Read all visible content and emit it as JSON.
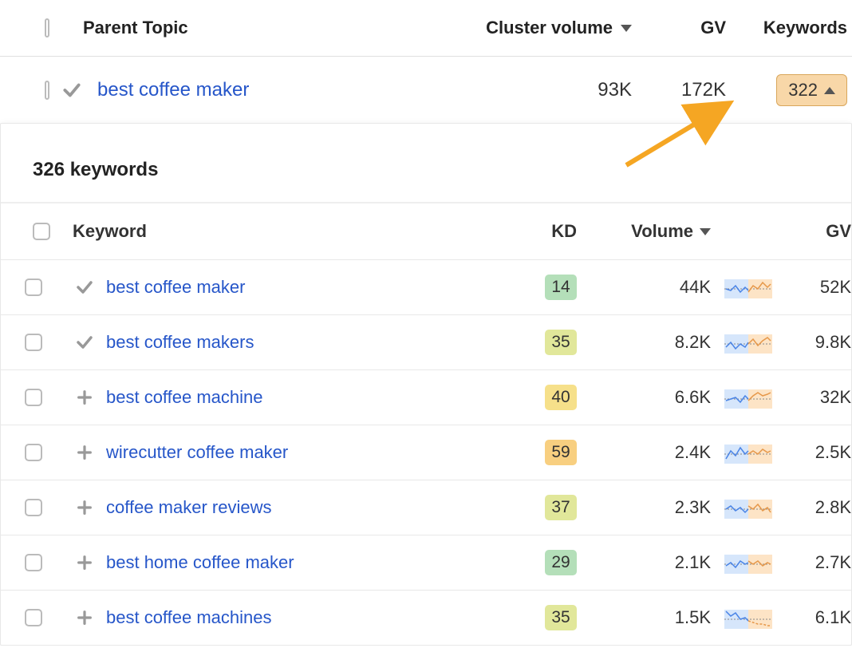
{
  "parent_table": {
    "headers": {
      "parent_topic": "Parent Topic",
      "cluster_volume": "Cluster volume",
      "gv": "GV",
      "keywords": "Keywords"
    },
    "row": {
      "topic": "best coffee maker",
      "cluster_volume": "93K",
      "gv": "172K",
      "keywords_count": "322"
    }
  },
  "panel": {
    "title": "326 keywords",
    "headers": {
      "keyword": "Keyword",
      "kd": "KD",
      "volume": "Volume",
      "gv": "GV"
    },
    "rows": [
      {
        "status": "check",
        "keyword": "best coffee maker",
        "kd": "14",
        "kd_class": "kd-green",
        "volume": "44K",
        "gv": "52K"
      },
      {
        "status": "check",
        "keyword": "best coffee makers",
        "kd": "35",
        "kd_class": "kd-lime",
        "volume": "8.2K",
        "gv": "9.8K"
      },
      {
        "status": "plus",
        "keyword": "best coffee machine",
        "kd": "40",
        "kd_class": "kd-yellow",
        "volume": "6.6K",
        "gv": "32K"
      },
      {
        "status": "plus",
        "keyword": "wirecutter coffee maker",
        "kd": "59",
        "kd_class": "kd-orange",
        "volume": "2.4K",
        "gv": "2.5K"
      },
      {
        "status": "plus",
        "keyword": "coffee maker reviews",
        "kd": "37",
        "kd_class": "kd-lime",
        "volume": "2.3K",
        "gv": "2.8K"
      },
      {
        "status": "plus",
        "keyword": "best home coffee maker",
        "kd": "29",
        "kd_class": "kd-green",
        "volume": "2.1K",
        "gv": "2.7K"
      },
      {
        "status": "plus",
        "keyword": "best coffee machines",
        "kd": "35",
        "kd_class": "kd-lime",
        "volume": "1.5K",
        "gv": "6.1K"
      }
    ]
  }
}
